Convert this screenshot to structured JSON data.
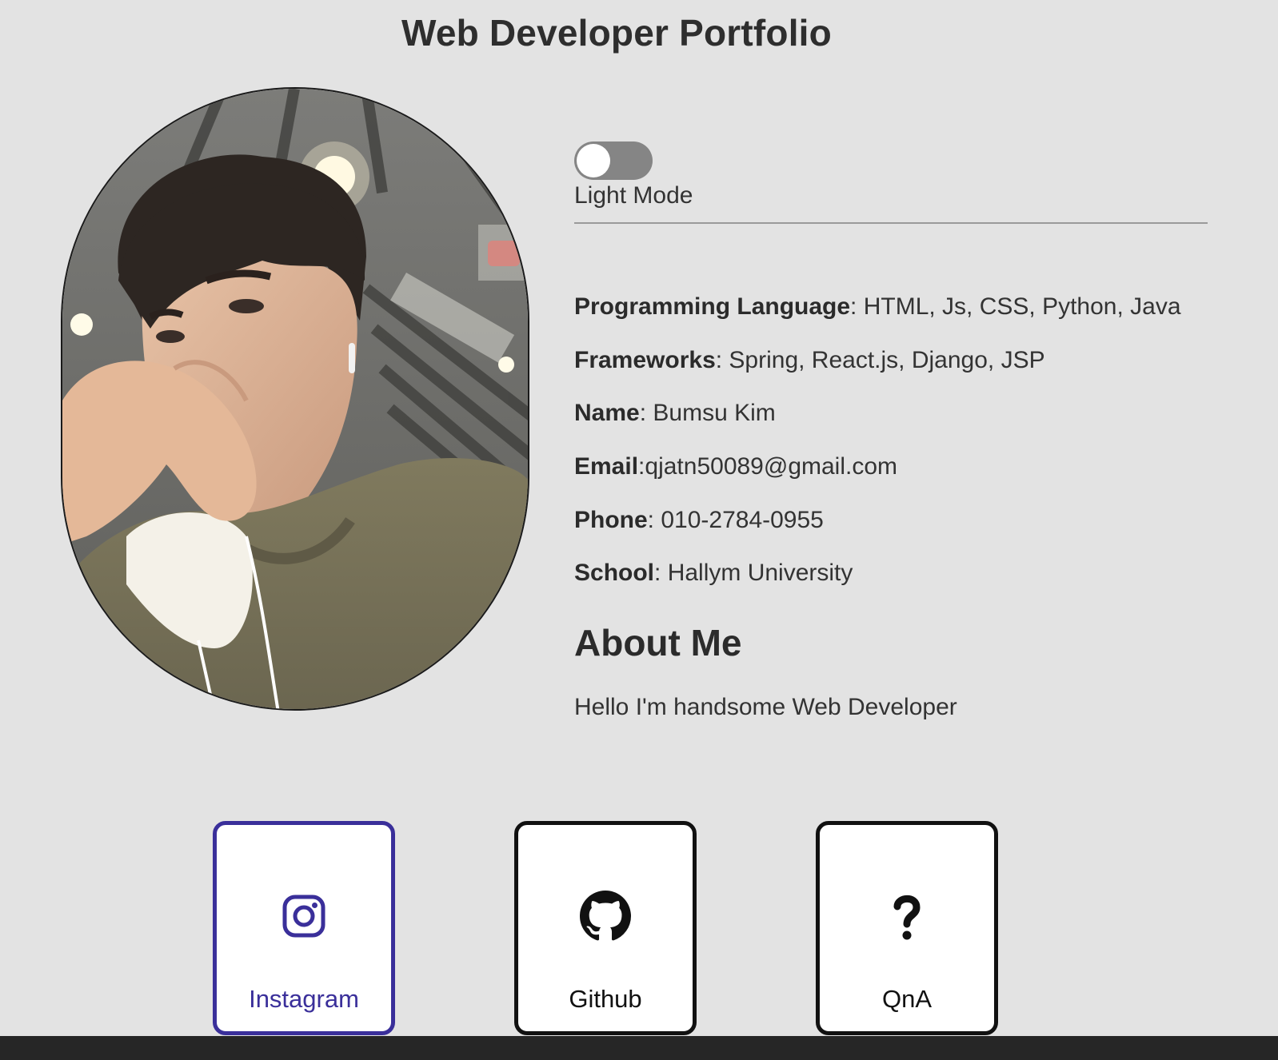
{
  "header": {
    "title": "Web Developer Portfolio"
  },
  "theme_toggle": {
    "label": "Light Mode",
    "state": "off"
  },
  "info": [
    {
      "key": "Programming Language",
      "sep": ": ",
      "value": "HTML, Js, CSS, Python, Java"
    },
    {
      "key": "Frameworks",
      "sep": ": ",
      "value": "Spring, React.js, Django, JSP"
    },
    {
      "key": "Name",
      "sep": ": ",
      "value": "Bumsu Kim"
    },
    {
      "key": "Email",
      "sep": ":",
      "value": "qjatn50089@gmail.com"
    },
    {
      "key": "Phone",
      "sep": ": ",
      "value": "010-2784-0955"
    },
    {
      "key": "School",
      "sep": ": ",
      "value": "Hallym University"
    }
  ],
  "about": {
    "heading": "About Me",
    "text": "Hello I'm handsome Web Developer"
  },
  "links": [
    {
      "label": "Instagram",
      "icon": "instagram-icon",
      "active": true
    },
    {
      "label": "Github",
      "icon": "github-icon",
      "active": false
    },
    {
      "label": "QnA",
      "icon": "question-icon",
      "active": false
    }
  ],
  "colors": {
    "background": "#e3e3e3",
    "accent": "#3a2f9a",
    "toggle_track": "#858585"
  }
}
